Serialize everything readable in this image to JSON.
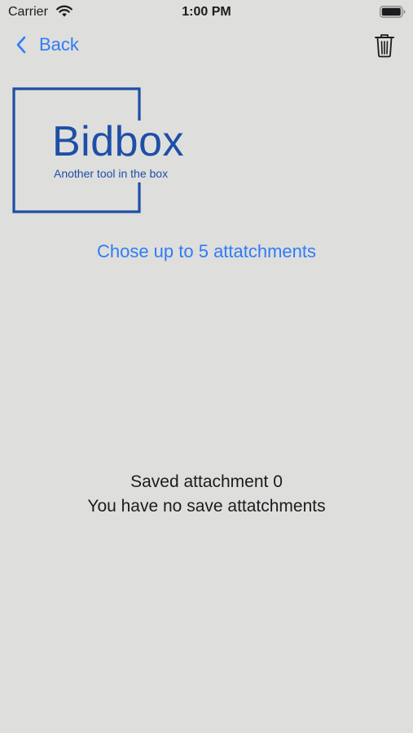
{
  "status_bar": {
    "carrier": "Carrier",
    "time": "1:00 PM"
  },
  "nav": {
    "back_label": "Back",
    "trash_icon": "trash-icon"
  },
  "logo": {
    "name": "Bidbox",
    "tagline": "Another tool in the box",
    "color": "#1d4fa8"
  },
  "actions": {
    "choose_label": "Chose up to 5 attatchments"
  },
  "content": {
    "saved_count": "Saved attachment 0",
    "empty_message": "You have no save attatchments"
  },
  "colors": {
    "accent": "#2f7cf6",
    "background": "#dededc"
  }
}
